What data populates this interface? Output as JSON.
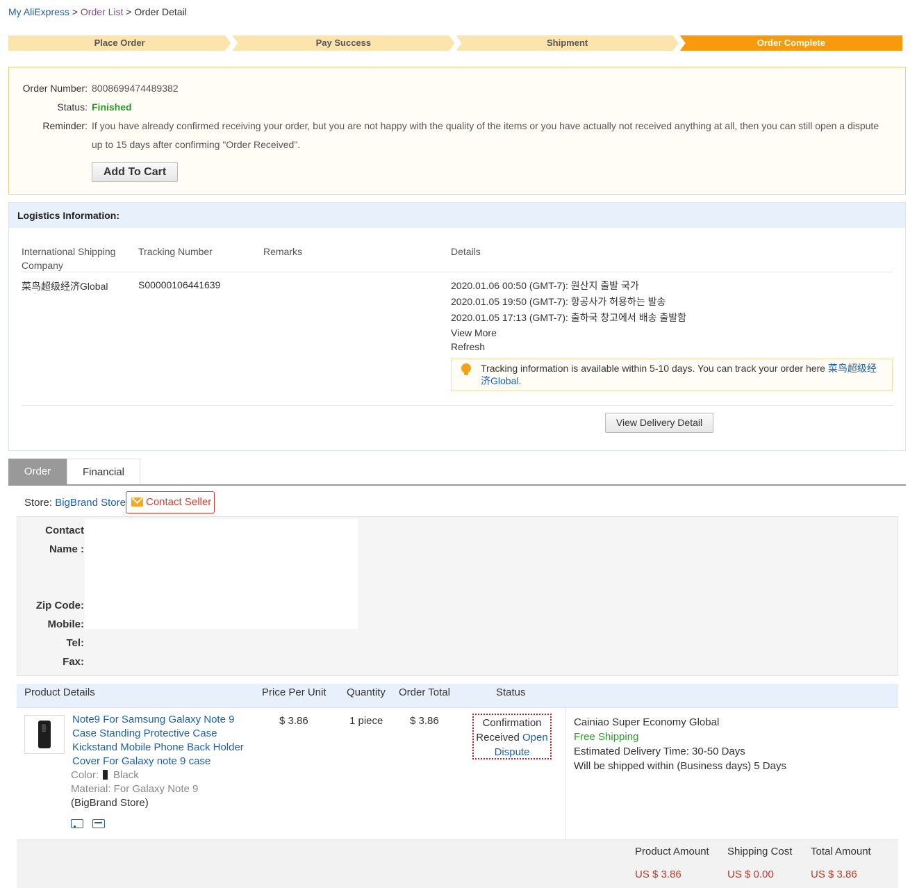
{
  "breadcrumb": {
    "home": "My AliExpress",
    "sep1": ">",
    "order_list": "Order List",
    "sep2": ">",
    "current": "Order Detail"
  },
  "steps": [
    "Place Order",
    "Pay Success",
    "Shipment",
    "Order Complete"
  ],
  "active_step": "Order Complete",
  "order": {
    "number_label": "Order Number:",
    "number": "8008699474489382",
    "status_label": "Status:",
    "status": "Finished",
    "reminder_label": "Reminder:",
    "reminder": "If you have already confirmed receiving your order, but you are not happy with the quality of the items or you have actually not received anything at all, then you can still open a dispute up to 15 days after confirming \"Order Received\".",
    "add_to_cart": "Add To Cart"
  },
  "logistics": {
    "title": "Logistics Information:",
    "columns": [
      "International Shipping Company",
      "Tracking Number",
      "Remarks",
      "Details"
    ],
    "company": "菜鸟超级经济Global",
    "tracking_number": "S00000106441639",
    "details": [
      "2020.01.06 00:50 (GMT-7): 원산지 출발 국가",
      "2020.01.05 19:50 (GMT-7): 항공사가 허용하는 발송",
      "2020.01.05 17:13 (GMT-7): 출하국 창고에서 배송 출발함"
    ],
    "view_more": "View More",
    "refresh": "Refresh",
    "tip_text": "Tracking information is available within 5-10 days. You can track your order here ",
    "tip_link": "菜鸟超级经济Global",
    "tip_end": ".",
    "view_delivery": "View Delivery Detail"
  },
  "tabs": [
    "Order",
    "Financial"
  ],
  "store": {
    "label": "Store:",
    "name": "BigBrand Store",
    "contact_seller": "Contact Seller"
  },
  "address": {
    "contact_name_line1": "Contact",
    "contact_name_line2": "Name :",
    "zip": "Zip Code:",
    "mobile": "Mobile:",
    "tel": "Tel:",
    "fax": "Fax:"
  },
  "product_table": {
    "headers": [
      "Product Details",
      "Price Per Unit",
      "Quantity",
      "Order Total",
      "Status"
    ],
    "product": {
      "title": "Note9 For Samsung Galaxy Note 9 Case Standing Protective Case Kickstand Mobile Phone Back Holder Cover For Galaxy note 9 case",
      "color_label": "Color:",
      "color_value": "Black",
      "material": "Material: For Galaxy Note 9",
      "store": "(BigBrand Store)",
      "price": "$ 3.86",
      "quantity": "1 piece",
      "total": "$ 3.86",
      "status_line1": "Confirmation",
      "status_line2": "Received",
      "status_link1": "Open",
      "status_link2": "Dispute"
    },
    "shipping": {
      "method": "Cainiao Super Economy Global",
      "free": "Free Shipping",
      "delivery_time": "Estimated Delivery Time:  30-50 Days",
      "ship_within": "Will be shipped within (Business days)  5 Days"
    }
  },
  "totals": {
    "product_amount_label": "Product Amount",
    "shipping_cost_label": "Shipping Cost",
    "total_amount_label": "Total Amount",
    "product_amount": "US $ 3.86",
    "shipping_cost": "US $ 0.00",
    "total_amount": "US $ 3.86"
  },
  "colors": {
    "link": "#1a5fb4",
    "step_inactive": "#fde4ad",
    "step_active": "#f89a0b",
    "status_finished": "#2a9a2a",
    "price_red": "#c0392b",
    "dispute_border": "#d9121c"
  }
}
